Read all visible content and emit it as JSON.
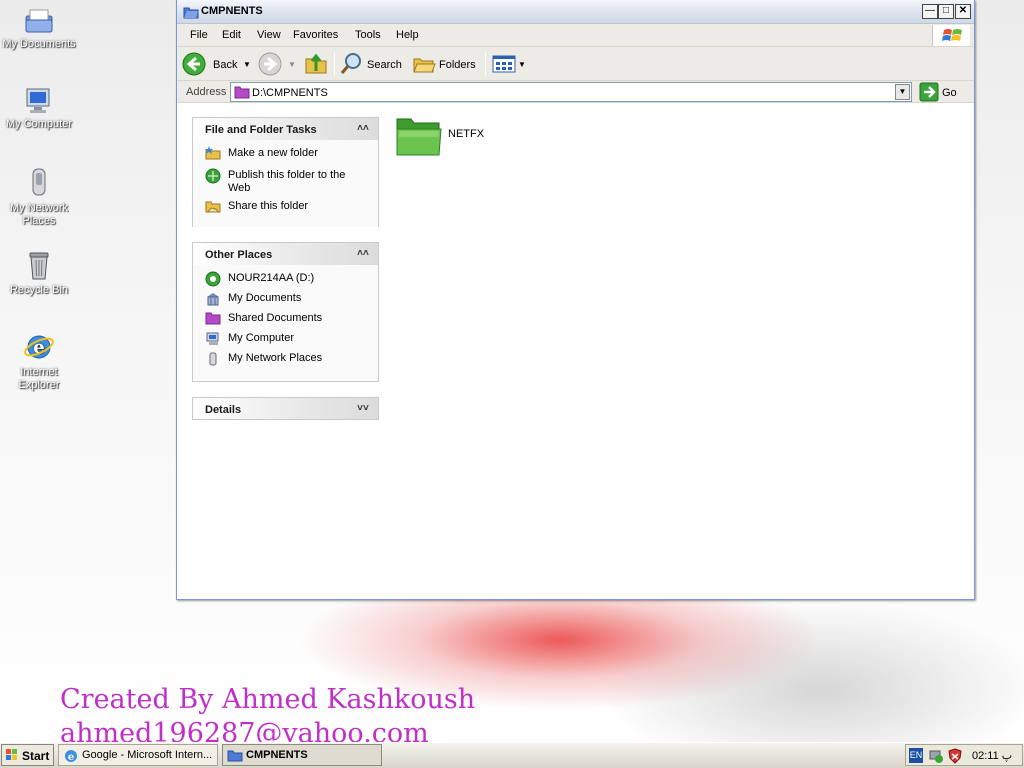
{
  "desktop": {
    "icons": [
      {
        "label": "My Documents"
      },
      {
        "label": "My Computer"
      },
      {
        "label": "My Network Places"
      },
      {
        "label": "Recycle Bin"
      },
      {
        "label": "Internet Explorer"
      }
    ],
    "credit_line1": "Created By Ahmed Kashkoush",
    "credit_line2": "ahmed196287@yahoo.com"
  },
  "window": {
    "title": "CMPNENTS",
    "menu": [
      "File",
      "Edit",
      "View",
      "Favorites",
      "Tools",
      "Help"
    ],
    "toolbar": {
      "back": "Back",
      "search": "Search",
      "folders": "Folders"
    },
    "address": {
      "label": "Address",
      "value": "D:\\CMPNENTS",
      "go": "Go"
    },
    "panes": {
      "file_tasks": {
        "title": "File and Folder Tasks",
        "items": [
          "Make a new folder",
          "Publish this folder to the Web",
          "Share this folder"
        ]
      },
      "other_places": {
        "title": "Other Places",
        "items": [
          "NOUR214AA (D:)",
          "My Documents",
          "Shared Documents",
          "My Computer",
          "My Network Places"
        ]
      },
      "details": {
        "title": "Details"
      }
    },
    "files": [
      {
        "name": "NETFX",
        "type": "folder"
      }
    ]
  },
  "taskbar": {
    "start": "Start",
    "tasks": [
      {
        "label": "Google - Microsoft Intern..."
      },
      {
        "label": "CMPNENTS"
      }
    ],
    "lang": "EN",
    "clock": "02:11 پ"
  }
}
